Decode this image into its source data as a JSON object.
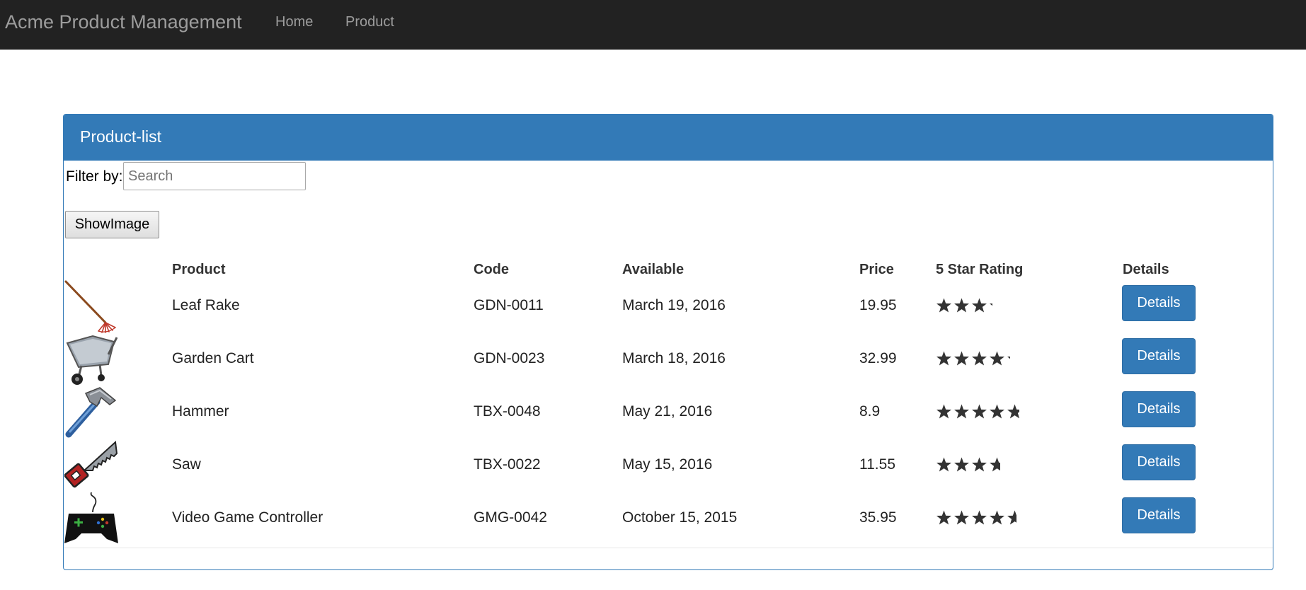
{
  "navbar": {
    "brand": "Acme Product Management",
    "links": [
      "Home",
      "Product"
    ]
  },
  "panel": {
    "title": "Product-list",
    "filter_label": "Filter by:",
    "filter_placeholder": "Search",
    "filter_value": "",
    "show_image_label": "ShowImage"
  },
  "table": {
    "headers": [
      "Product",
      "Code",
      "Available",
      "Price",
      "5 Star Rating",
      "Details"
    ],
    "rows": [
      {
        "image": "leaf-rake-image",
        "name": "Leaf Rake",
        "code": "GDN-0011",
        "available": "March 19, 2016",
        "price": "19.95",
        "rating": 3.2,
        "details": "Details"
      },
      {
        "image": "garden-cart-image",
        "name": "Garden Cart",
        "code": "GDN-0023",
        "available": "March 18, 2016",
        "price": "32.99",
        "rating": 4.2,
        "details": "Details"
      },
      {
        "image": "hammer-image",
        "name": "Hammer",
        "code": "TBX-0048",
        "available": "May 21, 2016",
        "price": "8.9",
        "rating": 4.8,
        "details": "Details"
      },
      {
        "image": "saw-image",
        "name": "Saw",
        "code": "TBX-0022",
        "available": "May 15, 2016",
        "price": "11.55",
        "rating": 3.7,
        "details": "Details"
      },
      {
        "image": "video-game-controller-image",
        "name": "Video Game Controller",
        "code": "GMG-0042",
        "available": "October 15, 2015",
        "price": "35.95",
        "rating": 4.6,
        "details": "Details"
      }
    ]
  },
  "colors": {
    "navbar_bg": "#222222",
    "navbar_text": "#9d9d9d",
    "primary": "#337ab7",
    "star": "#333333"
  }
}
